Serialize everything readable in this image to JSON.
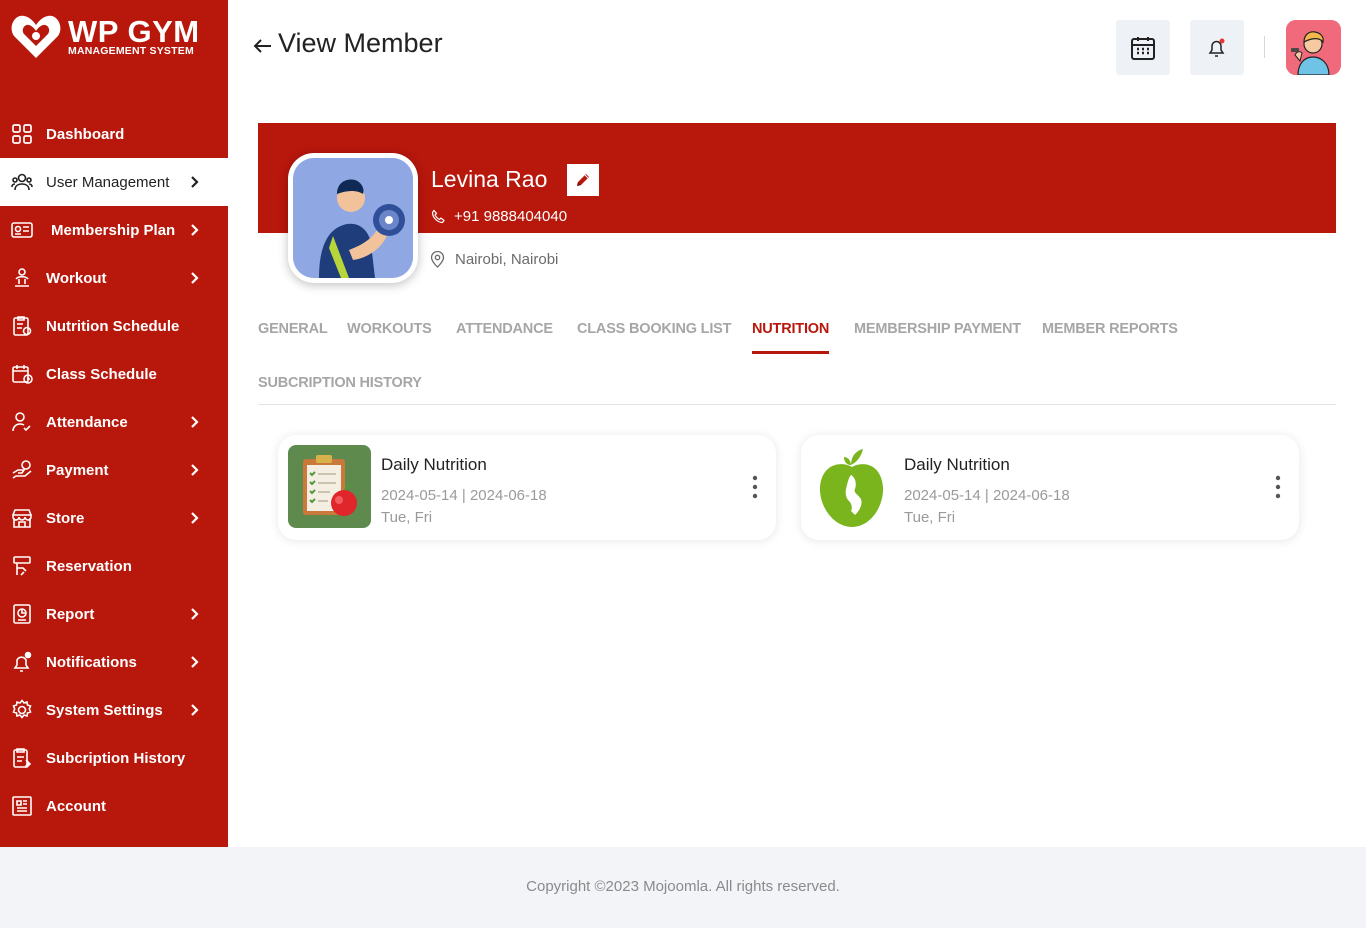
{
  "brand": {
    "title": "WP GYM",
    "subtitle": "MANAGEMENT SYSTEM"
  },
  "sidebar": {
    "items": [
      {
        "label": "Dashboard",
        "icon": "grid-icon",
        "chevron": false
      },
      {
        "label": "User Management",
        "icon": "users-icon",
        "chevron": true,
        "active": true
      },
      {
        "label": "Membership Plan",
        "icon": "id-card-icon",
        "chevron": true
      },
      {
        "label": "Workout",
        "icon": "workout-icon",
        "chevron": true
      },
      {
        "label": "Nutrition Schedule",
        "icon": "nutrition-icon",
        "chevron": false
      },
      {
        "label": "Class Schedule",
        "icon": "calendar-icon",
        "chevron": false
      },
      {
        "label": "Attendance",
        "icon": "user-check-icon",
        "chevron": true
      },
      {
        "label": "Payment",
        "icon": "payment-icon",
        "chevron": true
      },
      {
        "label": "Store",
        "icon": "store-icon",
        "chevron": true
      },
      {
        "label": "Reservation",
        "icon": "reservation-icon",
        "chevron": false
      },
      {
        "label": "Report",
        "icon": "report-icon",
        "chevron": true
      },
      {
        "label": "Notifications",
        "icon": "bell-icon",
        "chevron": true
      },
      {
        "label": "System Settings",
        "icon": "gear-icon",
        "chevron": true
      },
      {
        "label": "Subcription History",
        "icon": "history-icon",
        "chevron": false
      },
      {
        "label": "Account",
        "icon": "account-icon",
        "chevron": false
      }
    ]
  },
  "header": {
    "title": "View Member"
  },
  "member": {
    "name": "Levina Rao",
    "phone": "+91  9888404040",
    "location": "Nairobi, Nairobi"
  },
  "tabs": [
    {
      "label": "GENERAL"
    },
    {
      "label": "WORKOUTS"
    },
    {
      "label": "ATTENDANCE"
    },
    {
      "label": "CLASS BOOKING LIST"
    },
    {
      "label": "NUTRITION",
      "active": true
    },
    {
      "label": "MEMBERSHIP PAYMENT"
    },
    {
      "label": "MEMBER REPORTS"
    },
    {
      "label": "SUBCRIPTION HISTORY"
    }
  ],
  "nutrition_cards": [
    {
      "title": "Daily Nutrition",
      "dates": "2024-05-14 | 2024-06-18",
      "days": "Tue, Fri",
      "thumb": "clipboard-apple-icon"
    },
    {
      "title": "Daily Nutrition",
      "dates": "2024-05-14 | 2024-06-18",
      "days": "Tue, Fri",
      "thumb": "green-apple-icon"
    }
  ],
  "footer": {
    "copyright": "Copyright ©2023 Mojoomla. All rights reserved."
  },
  "colors": {
    "brand": "#b8170c",
    "muted": "#a6a6a6",
    "footer_bg": "#f2f4f8"
  }
}
